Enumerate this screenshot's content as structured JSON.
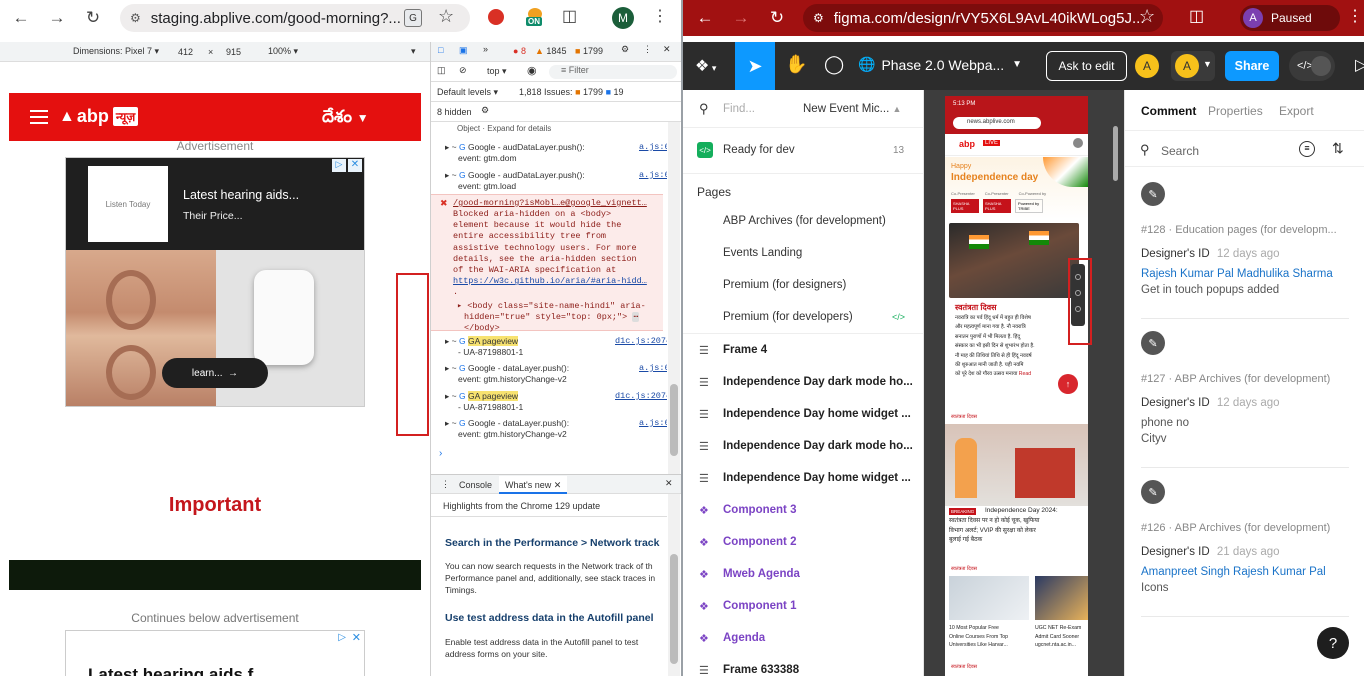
{
  "left_browser": {
    "url": "staging.abplive.com/good-morning?...",
    "profile_initial": "M",
    "ext_badge": "ON",
    "device_toolbar": {
      "dimensions_label": "Dimensions: Pixel 7",
      "width": "412",
      "x": "×",
      "height": "915",
      "zoom": "100%"
    },
    "site": {
      "brand": "abp",
      "brand_hindi": "न्यूज़",
      "lang_switch": "దేశం",
      "ad_label": "Advertisement",
      "ad_title": "Latest hearing aids...",
      "ad_subtitle": "Their Price...",
      "ad_logo_text": "Listen Today",
      "ad_cta": "learn...",
      "important": "Important",
      "continues": "Continues below advertisement",
      "ad2_title": "Latest hearing aids f..."
    },
    "devtools": {
      "errors": "8",
      "warnings": "1845",
      "issues_count": "1799",
      "context": "top",
      "filter_placeholder": "Filter",
      "levels": "Default levels",
      "issues_label": "1,818 Issues:",
      "issues_warn": "1799",
      "issues_info": "19",
      "hidden": "8 hidden",
      "obj_hint": "Object · Expand for details",
      "logs": [
        {
          "title": "Google - audDataLayer.push():",
          "sub": "event: gtm.dom",
          "src": "a.js:6"
        },
        {
          "title": "Google - audDataLayer.push():",
          "sub": "event: gtm.load",
          "src": "a.js:6"
        }
      ],
      "error_url": "/good-morning?isMobl…e@google_vignett…",
      "error_lines": [
        "Blocked aria-hidden on a <body>",
        "element because it would hide the",
        "entire accessibility tree from",
        "assistive technology users. For more",
        "details, see the aria-hidden section",
        "of the WAI-ARIA specification at"
      ],
      "error_link": "https://w3c.github.io/aria/#aria-hidd…",
      "error_dot": ".",
      "body_line1": "<body class=\"site-name-hindi\" aria-",
      "body_line2": "hidden=\"true\" style=\"top: 0px;\">",
      "body_line3": "</body>",
      "logs2": [
        {
          "title": "GA pageview",
          "sub": "- UA-87198801-1",
          "src": "d1c.js:2074",
          "hl": true
        },
        {
          "title": "Google - dataLayer.push():",
          "sub": "event: gtm.historyChange-v2",
          "src": "a.js:6",
          "hl": false
        },
        {
          "title": "GA pageview",
          "sub": "- UA-87198801-1",
          "src": "d1c.js:2074",
          "hl": true
        },
        {
          "title": "Google - dataLayer.push():",
          "sub": "event: gtm.historyChange-v2",
          "src": "a.js:6",
          "hl": false
        }
      ],
      "drawer_tabs": [
        "Console",
        "What's new"
      ],
      "whats_new_header": "Highlights from the Chrome 129 update",
      "wn1_title": "Search in the Performance > Network track",
      "wn1_lines": [
        "You can now search requests in the Network track of th",
        "Performance panel and, additionally, see stack traces in",
        "Timings."
      ],
      "wn2_title": "Use test address data in the Autofill panel",
      "wn2_lines": [
        "Enable test address data in the Autofill panel to test",
        "address forms on your site."
      ]
    }
  },
  "right_browser": {
    "url": "figma.com/design/rVY5X6L9AvL40ikWLog5J...",
    "profile_initial": "A",
    "profile_status": "Paused",
    "figma": {
      "file_name": "Phase 2.0 Webpa...",
      "ask_edit": "Ask to edit",
      "avatar1": "A",
      "avatar2": "A",
      "share": "Share",
      "find_placeholder": "Find...",
      "current_page": "New Event Mic...",
      "ready": "Ready for dev",
      "ready_count": "13",
      "pages_label": "Pages",
      "pages": [
        "ABP Archives (for development)",
        "Events Landing",
        "Premium (for designers)",
        "Premium (for developers)"
      ],
      "layers": [
        {
          "name": "Frame 4",
          "type": "frame"
        },
        {
          "name": "Independence Day dark mode ho...",
          "type": "frame"
        },
        {
          "name": "Independence Day home widget ...",
          "type": "frame"
        },
        {
          "name": "Independence Day dark mode ho...",
          "type": "frame"
        },
        {
          "name": "Independence Day home widget ...",
          "type": "frame"
        },
        {
          "name": "Component 3",
          "type": "component"
        },
        {
          "name": "Component 2",
          "type": "component"
        },
        {
          "name": "Mweb Agenda",
          "type": "component"
        },
        {
          "name": "Component 1",
          "type": "component"
        },
        {
          "name": "Agenda",
          "type": "component"
        },
        {
          "name": "Frame 633388",
          "type": "frame"
        }
      ],
      "right_tabs": [
        "Comment",
        "Properties",
        "Export"
      ],
      "search_placeholder": "Search",
      "comments": [
        {
          "meta": "#128 · Education pages (for developm...",
          "author": "Designer's ID",
          "time": "12 days ago",
          "mentions": "Rajesh Kumar Pal Madhulika Sharma",
          "text": "Get in touch popups added",
          "text2": ""
        },
        {
          "meta": "#127 · ABP Archives (for development)",
          "author": "Designer's ID",
          "time": "12 days ago",
          "mentions": "",
          "text": "phone no",
          "text2": "Cityv"
        },
        {
          "meta": "#126 · ABP Archives (for development)",
          "author": "Designer's ID",
          "time": "21 days ago",
          "mentions": "Amanpreet Singh Rajesh Kumar Pal",
          "text": "Icons",
          "text2": ""
        }
      ],
      "help": "?",
      "canvas": {
        "status_time": "5:13 PM",
        "mini_url": "news.abplive.com",
        "mini_brand": "abp",
        "mini_live": "LIVE",
        "happy": "Happy",
        "independence": "Independence day",
        "sponsors": [
          "Co-Presenter",
          "Co-Presenter",
          "Co-Powered by"
        ],
        "sponsor_badges": [
          "SHASHA PLUS",
          "SHASHA PLUS",
          "Powered by TRIBE"
        ],
        "headline_hindi": "स्वतंत्रता दिवस",
        "para_hindi": [
          "नवरात्रि का पर्व हिंदू धर्म में बहुत ही विशेष",
          "और महत्वपूर्ण माना गया है. नौ नवरात्रि",
          "सनातन पुराणों में भी मिलता है. हिंदू",
          "संस्कार का भी इसी दिन से शुभारंभ होता है.",
          "नौ माह की तिथियां तिथि से ही हिंदू नववर्ष",
          "की शुरुआत मानी जाती है. यही नवमि",
          "को पूरे देश को गौरव उत्सव मनाया"
        ],
        "read_more": "Read",
        "section1": "स्वतंत्रता दिवस",
        "breaking": "BREAKING",
        "story_title": "Independence Day 2024:",
        "story_hindi": [
          "स्वतंत्रता दिवस पर न हो कोई चूक, खुफिया",
          "विभाग अलर्ट; VVIP की सुरक्षा को लेकर",
          "बुलाई गई बैठक"
        ],
        "section2": "स्वतंत्रता दिवस",
        "card1": [
          "10 Most Popular Free",
          "Online Courses From Top",
          "Universities Like Harvar..."
        ],
        "card2": [
          "UGC NET Re-Exam",
          "Admit Card Sooner",
          "ugcnet.nta.ac.in..."
        ],
        "section3": "स्वतंत्रता दिवस"
      }
    }
  },
  "colors": {
    "abp_red": "#e4100f",
    "chrome_red": "#a11111",
    "figma_blue": "#0d99ff",
    "component_purple": "#7b43c4",
    "link_blue": "#1a73c8",
    "annotation_red": "#d32020"
  }
}
